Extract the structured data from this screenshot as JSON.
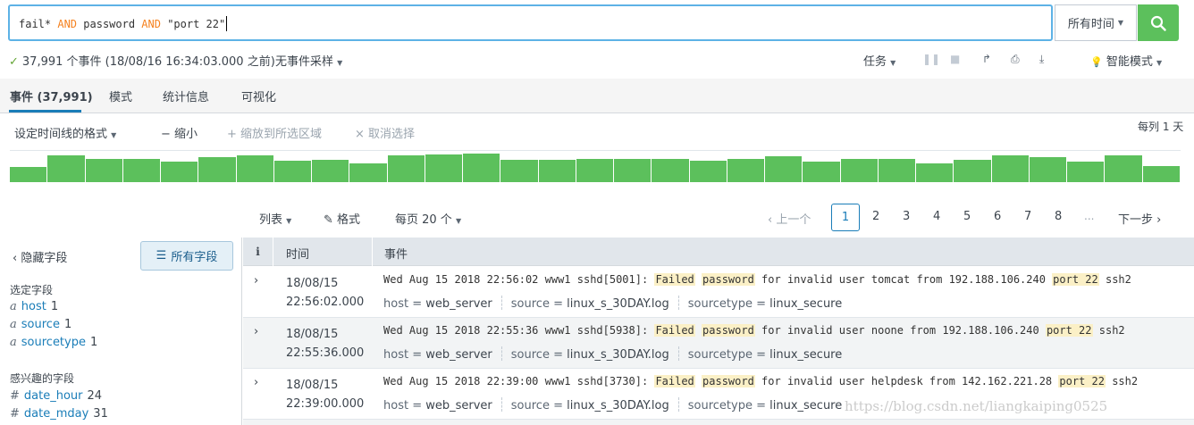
{
  "search": {
    "query_tokens": [
      {
        "text": "fail* ",
        "kw": false
      },
      {
        "text": "AND",
        "kw": true
      },
      {
        "text": " password ",
        "kw": false
      },
      {
        "text": "AND",
        "kw": true
      },
      {
        "text": " \"port 22\"",
        "kw": false
      }
    ],
    "time_picker": "所有时间",
    "colors": {
      "keyword": "#f58220",
      "border": "#5db2e6",
      "go": "#5cc05c"
    }
  },
  "status": {
    "summary": "37,991 个事件 (18/08/16 16:34:03.000 之前)",
    "sampling": "无事件采样",
    "job": "任务",
    "mode": "智能模式"
  },
  "tabs": [
    "事件 (37,991)",
    "模式",
    "统计信息",
    "可视化"
  ],
  "timeline": {
    "format": "设定时间线的格式",
    "zoom_out": "缩小",
    "zoom_to_selection": "缩放到所选区域",
    "deselect": "取消选择",
    "scale": "每列 1 天",
    "bars": [
      0.5,
      0.85,
      0.75,
      0.75,
      0.65,
      0.8,
      0.85,
      0.7,
      0.72,
      0.6,
      0.85,
      0.88,
      0.92,
      0.72,
      0.72,
      0.73,
      0.73,
      0.75,
      0.7,
      0.73,
      0.83,
      0.65,
      0.75,
      0.73,
      0.6,
      0.72,
      0.85,
      0.8,
      0.65,
      0.85,
      0.52
    ]
  },
  "controls": {
    "list": "列表",
    "format": "格式",
    "per_page": "每页 20 个",
    "prev": "上一个",
    "next": "下一步",
    "pages": [
      "1",
      "2",
      "3",
      "4",
      "5",
      "6",
      "7",
      "8"
    ],
    "ellipsis": "..."
  },
  "sidebar": {
    "hide_fields": "隐藏字段",
    "all_fields": "所有字段",
    "selected_title": "选定字段",
    "selected": [
      {
        "type": "a",
        "name": "host",
        "count": "1"
      },
      {
        "type": "a",
        "name": "source",
        "count": "1"
      },
      {
        "type": "a",
        "name": "sourcetype",
        "count": "1"
      }
    ],
    "interesting_title": "感兴趣的字段",
    "interesting": [
      {
        "type": "#",
        "name": "date_hour",
        "count": "24"
      },
      {
        "type": "#",
        "name": "date_mday",
        "count": "31"
      }
    ]
  },
  "results": {
    "header": {
      "i": "i",
      "time": "时间",
      "event": "事件"
    },
    "rows": [
      {
        "date": "18/08/15",
        "time": "22:56:02.000",
        "pre": "Wed Aug 15 2018 22:56:02 www1 sshd[5001]: ",
        "mid": " for invalid user tomcat from 192.188.106.240 ",
        "post": " ssh2",
        "host": "web_server",
        "source": "linux_s_30DAY.log",
        "sourcetype": "linux_secure"
      },
      {
        "date": "18/08/15",
        "time": "22:55:36.000",
        "pre": "Wed Aug 15 2018 22:55:36 www1 sshd[5938]: ",
        "mid": " for invalid user noone from 192.188.106.240 ",
        "post": " ssh2",
        "host": "web_server",
        "source": "linux_s_30DAY.log",
        "sourcetype": "linux_secure"
      },
      {
        "date": "18/08/15",
        "time": "22:39:00.000",
        "pre": "Wed Aug 15 2018 22:39:00 www1 sshd[3730]: ",
        "mid": " for invalid user helpdesk from 142.162.221.28 ",
        "post": " ssh2",
        "host": "web_server",
        "source": "linux_s_30DAY.log",
        "sourcetype": "linux_secure"
      }
    ],
    "hl": {
      "failed": "Failed",
      "password": "password",
      "port": "port 22"
    },
    "labels": {
      "host": "host = ",
      "source": "source = ",
      "sourcetype": "sourcetype = "
    }
  },
  "watermark": "https://blog.csdn.net/liangkaiping0525"
}
